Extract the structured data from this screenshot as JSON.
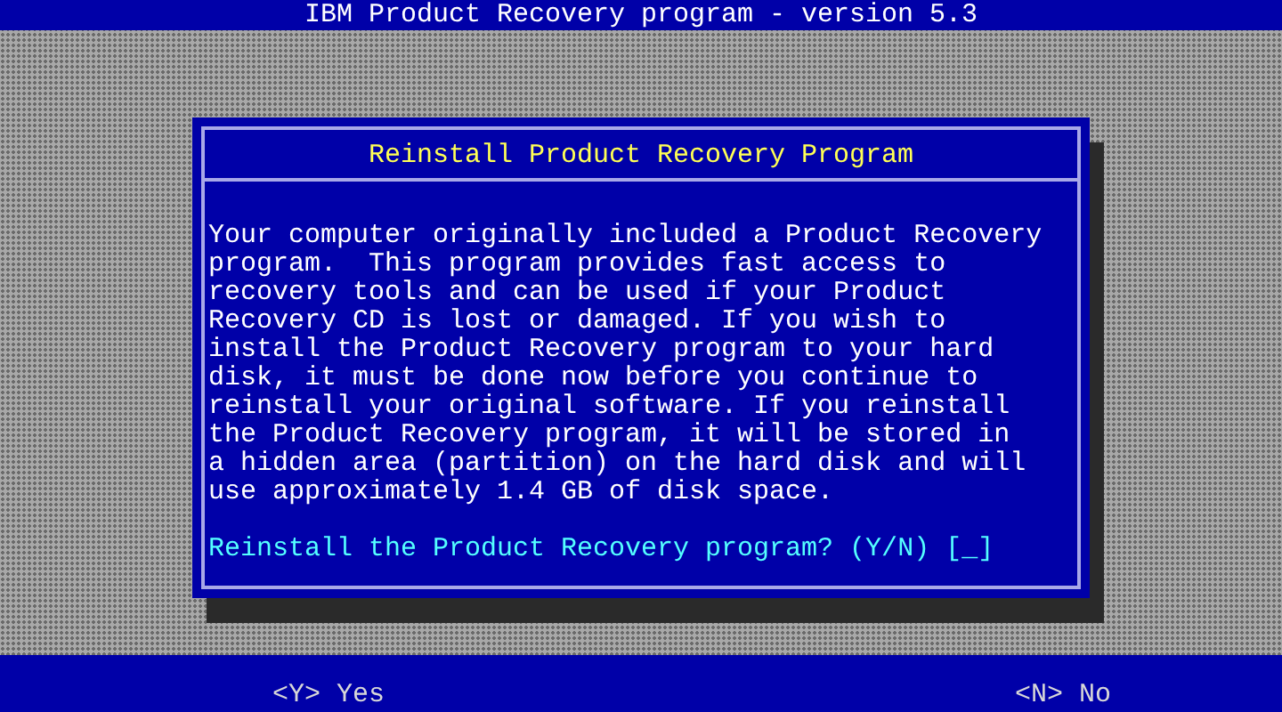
{
  "header": {
    "title": "IBM Product Recovery program - version 5.3"
  },
  "dialog": {
    "title": "Reinstall Product Recovery Program",
    "body_lines": [
      "Your computer originally included a Product Recovery",
      "program.  This program provides fast access to",
      "recovery tools and can be used if your Product",
      "Recovery CD is lost or damaged. If you wish to",
      "install the Product Recovery program to your hard",
      "disk, it must be done now before you continue to",
      "reinstall your original software. If you reinstall",
      "the Product Recovery program, it will be stored in",
      "a hidden area (partition) on the hard disk and will",
      "use approximately 1.4 GB of disk space."
    ],
    "prompt": "Reinstall the Product Recovery program? (Y/N) [_]"
  },
  "footer": {
    "options": [
      "<Y> Yes",
      "<N> No"
    ]
  }
}
